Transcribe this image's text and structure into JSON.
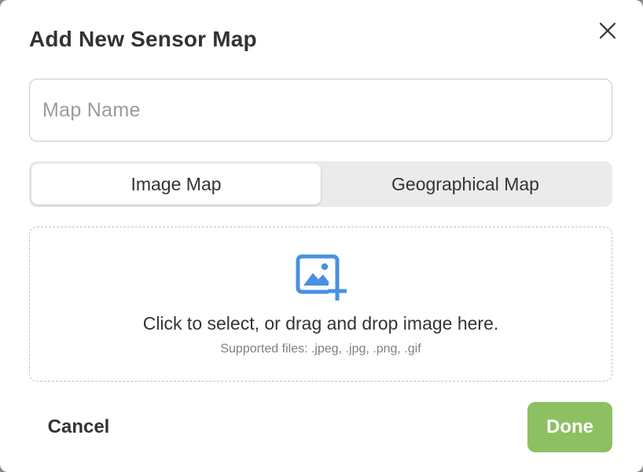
{
  "dialog": {
    "title": "Add New Sensor Map",
    "close_icon": "close-icon"
  },
  "map_name_input": {
    "placeholder": "Map Name",
    "value": ""
  },
  "map_type_toggle": {
    "options": [
      {
        "label": "Image Map",
        "selected": true
      },
      {
        "label": "Geographical Map",
        "selected": false
      }
    ]
  },
  "dropzone": {
    "icon": "add-image-icon",
    "instruction": "Click to select, or drag and drop image here.",
    "supported": "Supported files: .jpeg, .jpg, .png, .gif"
  },
  "actions": {
    "cancel_label": "Cancel",
    "done_label": "Done"
  },
  "colors": {
    "accent_blue": "#4a90e2",
    "done_green": "#8dc063"
  }
}
